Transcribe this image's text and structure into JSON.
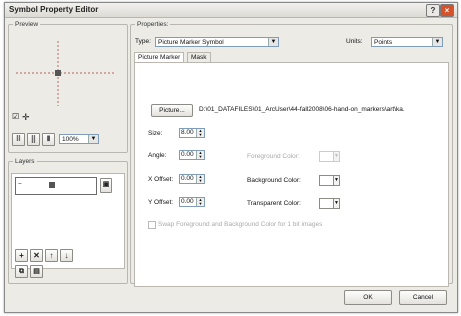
{
  "window": {
    "title": "Symbol Property Editor",
    "help_label": "?",
    "close_label": "×"
  },
  "preview": {
    "group_label": "Preview",
    "checkbox_glyph": "☑",
    "move_glyph": "✛",
    "zoom_value": "100%"
  },
  "layers": {
    "group_label": "Layers",
    "expand_glyph": "−"
  },
  "properties": {
    "group_label": "Properties:",
    "type_label": "Type:",
    "type_value": "Picture Marker Symbol",
    "units_label": "Units:",
    "units_value": "Points",
    "tabs": [
      {
        "label": "Picture Marker"
      },
      {
        "label": "Mask"
      }
    ],
    "picture_button": "Picture...",
    "picture_path": "D:\\01_DATAFILES\\01_ArcUser\\44-fall2008\\06-hand-on_markers\\art\\ka.",
    "size_label": "Size:",
    "size_value": "8.00",
    "angle_label": "Angle:",
    "angle_value": "0.00",
    "xoffset_label": "X Offset:",
    "xoffset_value": "0.00",
    "yoffset_label": "Y Offset:",
    "yoffset_value": "0.00",
    "foreground_label": "Foreground Color:",
    "background_label": "Background Color:",
    "transparent_label": "Transparent Color:",
    "swap_checkbox_label": "Swap Foreground and Background Color for 1 bit images"
  },
  "footer": {
    "ok_label": "OK",
    "cancel_label": "Cancel"
  }
}
